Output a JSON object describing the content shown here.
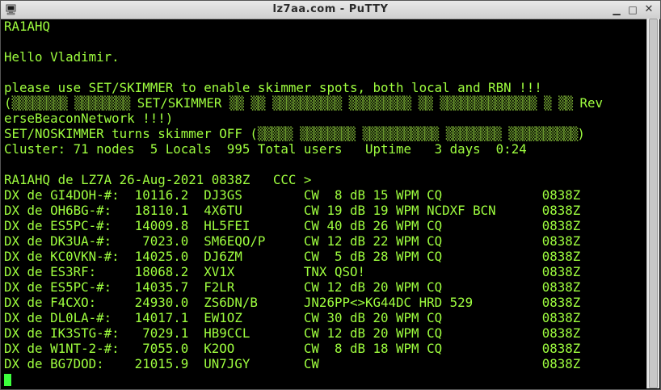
{
  "window": {
    "title": "lz7aa.com - PuTTY",
    "minimize": "▁",
    "maximize": "□",
    "close": "✕"
  },
  "terminal": {
    "callsign": "RA1AHQ",
    "greeting": "Hello Vladimir.",
    "skimmer_notice": "please use SET/SKIMMER to enable skimmer spots, both local and RBN !!!",
    "ru_line1": {
      "b1": "▒▒▒▒▒▒▒▒",
      "b2": "▒▒▒▒▒▒▒▒",
      "cmd": "SET/SKIMMER",
      "b3": "▒▒",
      "b4": "▒▒",
      "b5": "▒▒▒▒▒▒▒▒▒▒",
      "b6": "▒▒▒▒▒▒▒▒▒",
      "b7": "▒▒",
      "b8": "▒▒▒▒▒▒▒▒▒▒▒▒▒▒",
      "b9": "▒",
      "b10": "▒▒",
      "tail": "Rev"
    },
    "ru_line2": "erseBeaconNetwork !!!)",
    "noskimmer": {
      "text": "SET/NOSKIMMER turns skimmer OFF (",
      "b1": "▒▒▒▒▒",
      "b2": "▒▒▒▒▒▒▒▒",
      "b3": "▒▒▒▒▒▒▒▒▒▒▒",
      "b4": "▒▒▒▒▒▒▒▒",
      "b5": "▒▒▒▒▒▒▒▒▒▒",
      "end": ")"
    },
    "cluster_status": "Cluster: 71 nodes  5 Locals  995 Total users   Uptime   3 days  0:24",
    "prompt": "RA1AHQ de LZ7A 26-Aug-2021 0838Z   CCC >",
    "spots": [
      "DX de GI4DOH-#:  10116.2  DJ3GS        CW  8 dB 15 WPM CQ             0838Z",
      "DX de OH6BG-#:   18110.1  4X6TU        CW 19 dB 19 WPM NCDXF BCN      0838Z",
      "DX de ES5PC-#:   14009.8  HL5FEI       CW 40 dB 26 WPM CQ             0838Z",
      "DX de DK3UA-#:    7023.0  SM6EQO/P     CW 12 dB 22 WPM CQ             0838Z",
      "DX de KC0VKN-#:  14025.0  DJ6ZM        CW  5 dB 28 WPM CQ             0838Z",
      "DX de ES3RF:     18068.2  XV1X         TNX QSO!                       0838Z",
      "DX de ES5PC-#:   14035.7  F2LR         CW 12 dB 20 WPM CQ             0838Z",
      "DX de F4CXO:     24930.0  ZS6DN/B      JN26PP<>KG44DC HRD 529         0838Z",
      "DX de DL0LA-#:   14017.1  EW1OZ        CW 30 dB 20 WPM CQ             0838Z",
      "DX de IK3STG-#:   7029.1  HB9CCL       CW 12 dB 20 WPM CQ             0838Z",
      "DX de W1NT-2-#:   7055.0  K2OO         CW  8 dB 18 WPM CQ             0838Z",
      "DX de BG7DOD:    21015.9  UN7JGY       CW                             0838Z"
    ]
  },
  "colors": {
    "terminal_fg": "#9fff3f",
    "terminal_bg": "#000000",
    "cursor": "#3cff3c"
  }
}
